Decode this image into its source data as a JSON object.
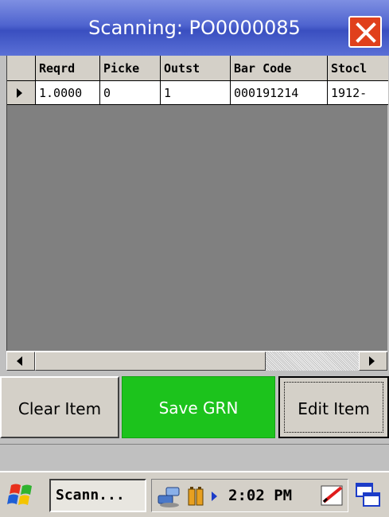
{
  "window": {
    "title": "Scanning: PO0000085",
    "close_icon": "close-icon"
  },
  "grid": {
    "columns": [
      "Reqrd",
      "Picke",
      "Outst",
      "Bar Code",
      "Stocl"
    ],
    "rows": [
      {
        "cells": [
          "1.0000",
          "0",
          "1",
          "000191214",
          "1912-"
        ]
      }
    ]
  },
  "buttons": {
    "clear_label": "Clear Item",
    "save_label": "Save GRN",
    "edit_label": "Edit Item"
  },
  "taskbar": {
    "task_label": "Scann...",
    "clock": "2:02 PM"
  },
  "colors": {
    "title_bar": "#4f64cf",
    "close_button": "#e0401c",
    "save_button": "#1cc31c",
    "grid_background": "#808080"
  },
  "icons": [
    "windows-start-icon",
    "network-icon",
    "battery-icon",
    "tray-arrow-icon",
    "pen-input-icon",
    "windows-switch-icon"
  ]
}
